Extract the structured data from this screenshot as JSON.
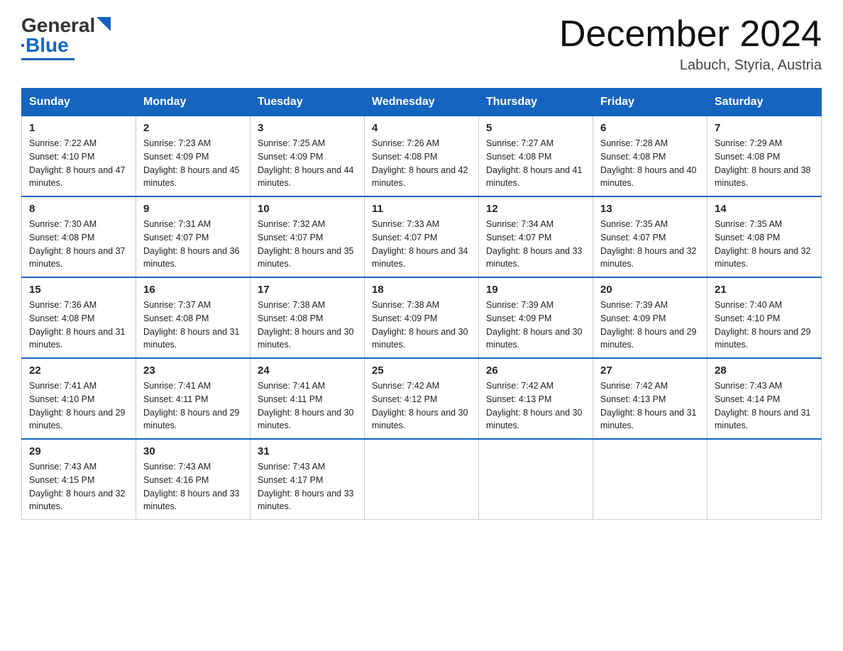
{
  "header": {
    "logo_general": "General",
    "logo_blue": "Blue",
    "month_title": "December 2024",
    "location": "Labuch, Styria, Austria"
  },
  "days_of_week": [
    "Sunday",
    "Monday",
    "Tuesday",
    "Wednesday",
    "Thursday",
    "Friday",
    "Saturday"
  ],
  "weeks": [
    [
      {
        "day": "1",
        "sunrise": "7:22 AM",
        "sunset": "4:10 PM",
        "daylight": "8 hours and 47 minutes."
      },
      {
        "day": "2",
        "sunrise": "7:23 AM",
        "sunset": "4:09 PM",
        "daylight": "8 hours and 45 minutes."
      },
      {
        "day": "3",
        "sunrise": "7:25 AM",
        "sunset": "4:09 PM",
        "daylight": "8 hours and 44 minutes."
      },
      {
        "day": "4",
        "sunrise": "7:26 AM",
        "sunset": "4:08 PM",
        "daylight": "8 hours and 42 minutes."
      },
      {
        "day": "5",
        "sunrise": "7:27 AM",
        "sunset": "4:08 PM",
        "daylight": "8 hours and 41 minutes."
      },
      {
        "day": "6",
        "sunrise": "7:28 AM",
        "sunset": "4:08 PM",
        "daylight": "8 hours and 40 minutes."
      },
      {
        "day": "7",
        "sunrise": "7:29 AM",
        "sunset": "4:08 PM",
        "daylight": "8 hours and 38 minutes."
      }
    ],
    [
      {
        "day": "8",
        "sunrise": "7:30 AM",
        "sunset": "4:08 PM",
        "daylight": "8 hours and 37 minutes."
      },
      {
        "day": "9",
        "sunrise": "7:31 AM",
        "sunset": "4:07 PM",
        "daylight": "8 hours and 36 minutes."
      },
      {
        "day": "10",
        "sunrise": "7:32 AM",
        "sunset": "4:07 PM",
        "daylight": "8 hours and 35 minutes."
      },
      {
        "day": "11",
        "sunrise": "7:33 AM",
        "sunset": "4:07 PM",
        "daylight": "8 hours and 34 minutes."
      },
      {
        "day": "12",
        "sunrise": "7:34 AM",
        "sunset": "4:07 PM",
        "daylight": "8 hours and 33 minutes."
      },
      {
        "day": "13",
        "sunrise": "7:35 AM",
        "sunset": "4:07 PM",
        "daylight": "8 hours and 32 minutes."
      },
      {
        "day": "14",
        "sunrise": "7:35 AM",
        "sunset": "4:08 PM",
        "daylight": "8 hours and 32 minutes."
      }
    ],
    [
      {
        "day": "15",
        "sunrise": "7:36 AM",
        "sunset": "4:08 PM",
        "daylight": "8 hours and 31 minutes."
      },
      {
        "day": "16",
        "sunrise": "7:37 AM",
        "sunset": "4:08 PM",
        "daylight": "8 hours and 31 minutes."
      },
      {
        "day": "17",
        "sunrise": "7:38 AM",
        "sunset": "4:08 PM",
        "daylight": "8 hours and 30 minutes."
      },
      {
        "day": "18",
        "sunrise": "7:38 AM",
        "sunset": "4:09 PM",
        "daylight": "8 hours and 30 minutes."
      },
      {
        "day": "19",
        "sunrise": "7:39 AM",
        "sunset": "4:09 PM",
        "daylight": "8 hours and 30 minutes."
      },
      {
        "day": "20",
        "sunrise": "7:39 AM",
        "sunset": "4:09 PM",
        "daylight": "8 hours and 29 minutes."
      },
      {
        "day": "21",
        "sunrise": "7:40 AM",
        "sunset": "4:10 PM",
        "daylight": "8 hours and 29 minutes."
      }
    ],
    [
      {
        "day": "22",
        "sunrise": "7:41 AM",
        "sunset": "4:10 PM",
        "daylight": "8 hours and 29 minutes."
      },
      {
        "day": "23",
        "sunrise": "7:41 AM",
        "sunset": "4:11 PM",
        "daylight": "8 hours and 29 minutes."
      },
      {
        "day": "24",
        "sunrise": "7:41 AM",
        "sunset": "4:11 PM",
        "daylight": "8 hours and 30 minutes."
      },
      {
        "day": "25",
        "sunrise": "7:42 AM",
        "sunset": "4:12 PM",
        "daylight": "8 hours and 30 minutes."
      },
      {
        "day": "26",
        "sunrise": "7:42 AM",
        "sunset": "4:13 PM",
        "daylight": "8 hours and 30 minutes."
      },
      {
        "day": "27",
        "sunrise": "7:42 AM",
        "sunset": "4:13 PM",
        "daylight": "8 hours and 31 minutes."
      },
      {
        "day": "28",
        "sunrise": "7:43 AM",
        "sunset": "4:14 PM",
        "daylight": "8 hours and 31 minutes."
      }
    ],
    [
      {
        "day": "29",
        "sunrise": "7:43 AM",
        "sunset": "4:15 PM",
        "daylight": "8 hours and 32 minutes."
      },
      {
        "day": "30",
        "sunrise": "7:43 AM",
        "sunset": "4:16 PM",
        "daylight": "8 hours and 33 minutes."
      },
      {
        "day": "31",
        "sunrise": "7:43 AM",
        "sunset": "4:17 PM",
        "daylight": "8 hours and 33 minutes."
      },
      null,
      null,
      null,
      null
    ]
  ]
}
